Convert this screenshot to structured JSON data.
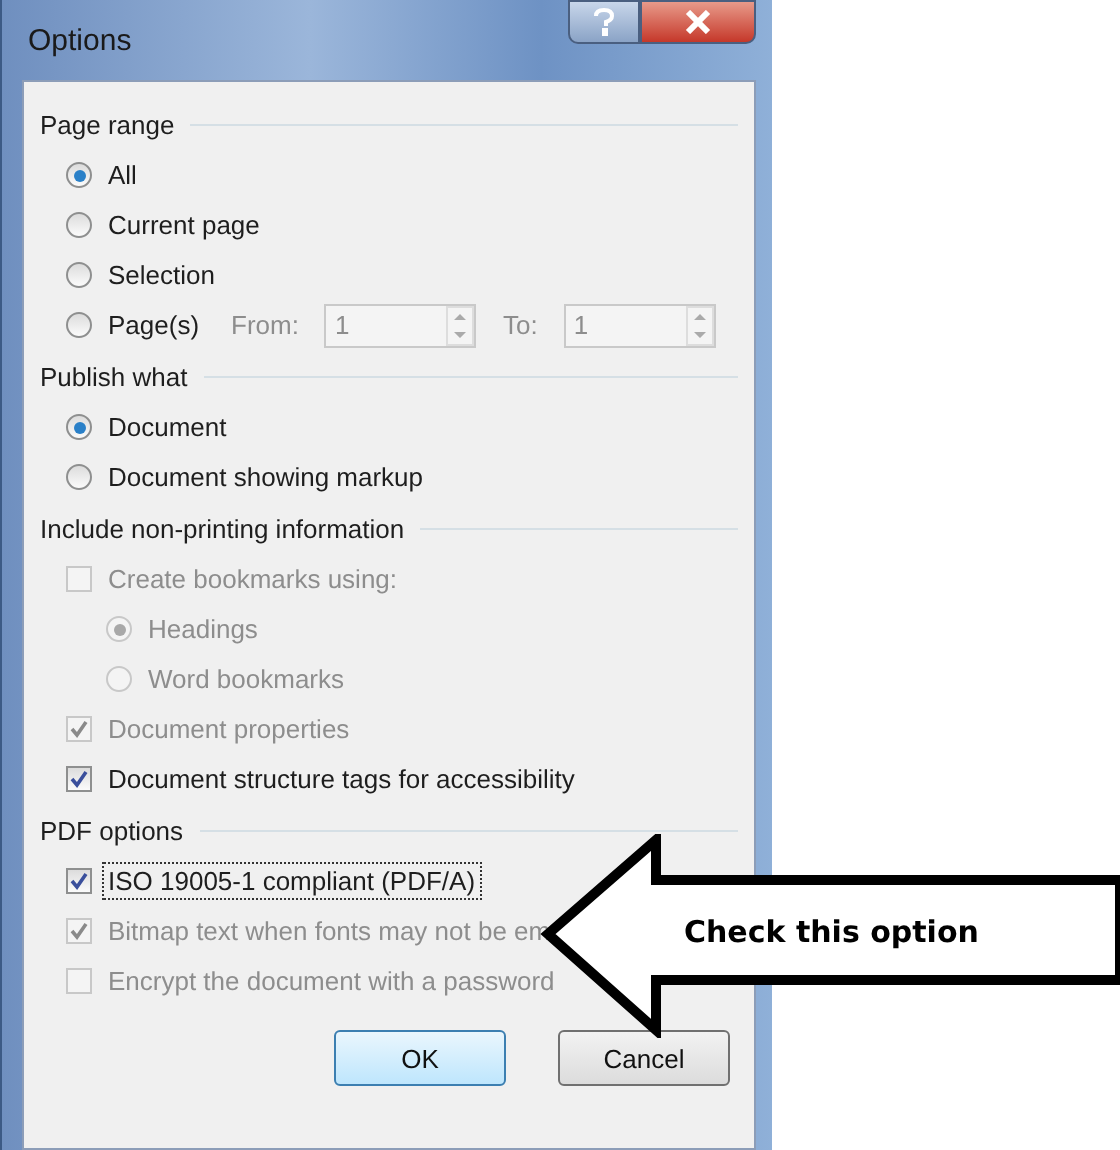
{
  "window": {
    "title": "Options"
  },
  "sections": [
    {
      "title": "Page range",
      "items": [
        {
          "kind": "radio",
          "label": "All",
          "checked": true,
          "disabled": false
        },
        {
          "kind": "radio",
          "label": "Current page",
          "checked": false,
          "disabled": false
        },
        {
          "kind": "radio",
          "label": "Selection",
          "checked": false,
          "disabled": false
        },
        {
          "kind": "radio",
          "label": "Page(s)",
          "checked": false,
          "disabled": false,
          "fields": [
            {
              "label": "From:",
              "value": "1",
              "disabled": true
            },
            {
              "label": "To:",
              "value": "1",
              "disabled": true
            }
          ]
        }
      ]
    },
    {
      "title": "Publish what",
      "items": [
        {
          "kind": "radio",
          "label": "Document",
          "checked": true,
          "disabled": false
        },
        {
          "kind": "radio",
          "label": "Document showing markup",
          "checked": false,
          "disabled": false
        }
      ]
    },
    {
      "title": "Include non-printing information",
      "items": [
        {
          "kind": "checkbox",
          "label": "Create bookmarks using:",
          "checked": false,
          "disabled": true,
          "children": [
            {
              "kind": "radio",
              "label": "Headings",
              "checked": true,
              "disabled": true
            },
            {
              "kind": "radio",
              "label": "Word bookmarks",
              "checked": false,
              "disabled": true
            }
          ]
        },
        {
          "kind": "checkbox",
          "label": "Document properties",
          "checked": true,
          "disabled": true
        },
        {
          "kind": "checkbox",
          "label": "Document structure tags for accessibility",
          "checked": true,
          "disabled": false
        }
      ]
    },
    {
      "title": "PDF options",
      "items": [
        {
          "kind": "checkbox",
          "label": "ISO 19005-1 compliant (PDF/A)",
          "checked": true,
          "disabled": false,
          "focused": true
        },
        {
          "kind": "checkbox",
          "label": "Bitmap text when fonts may not be em",
          "checked": true,
          "disabled": true
        },
        {
          "kind": "checkbox",
          "label": "Encrypt the document with a password",
          "checked": false,
          "disabled": true
        }
      ]
    }
  ],
  "buttons": [
    {
      "label": "OK",
      "default": true
    },
    {
      "label": "Cancel",
      "default": false
    }
  ],
  "callout": {
    "text": "Check this option"
  }
}
